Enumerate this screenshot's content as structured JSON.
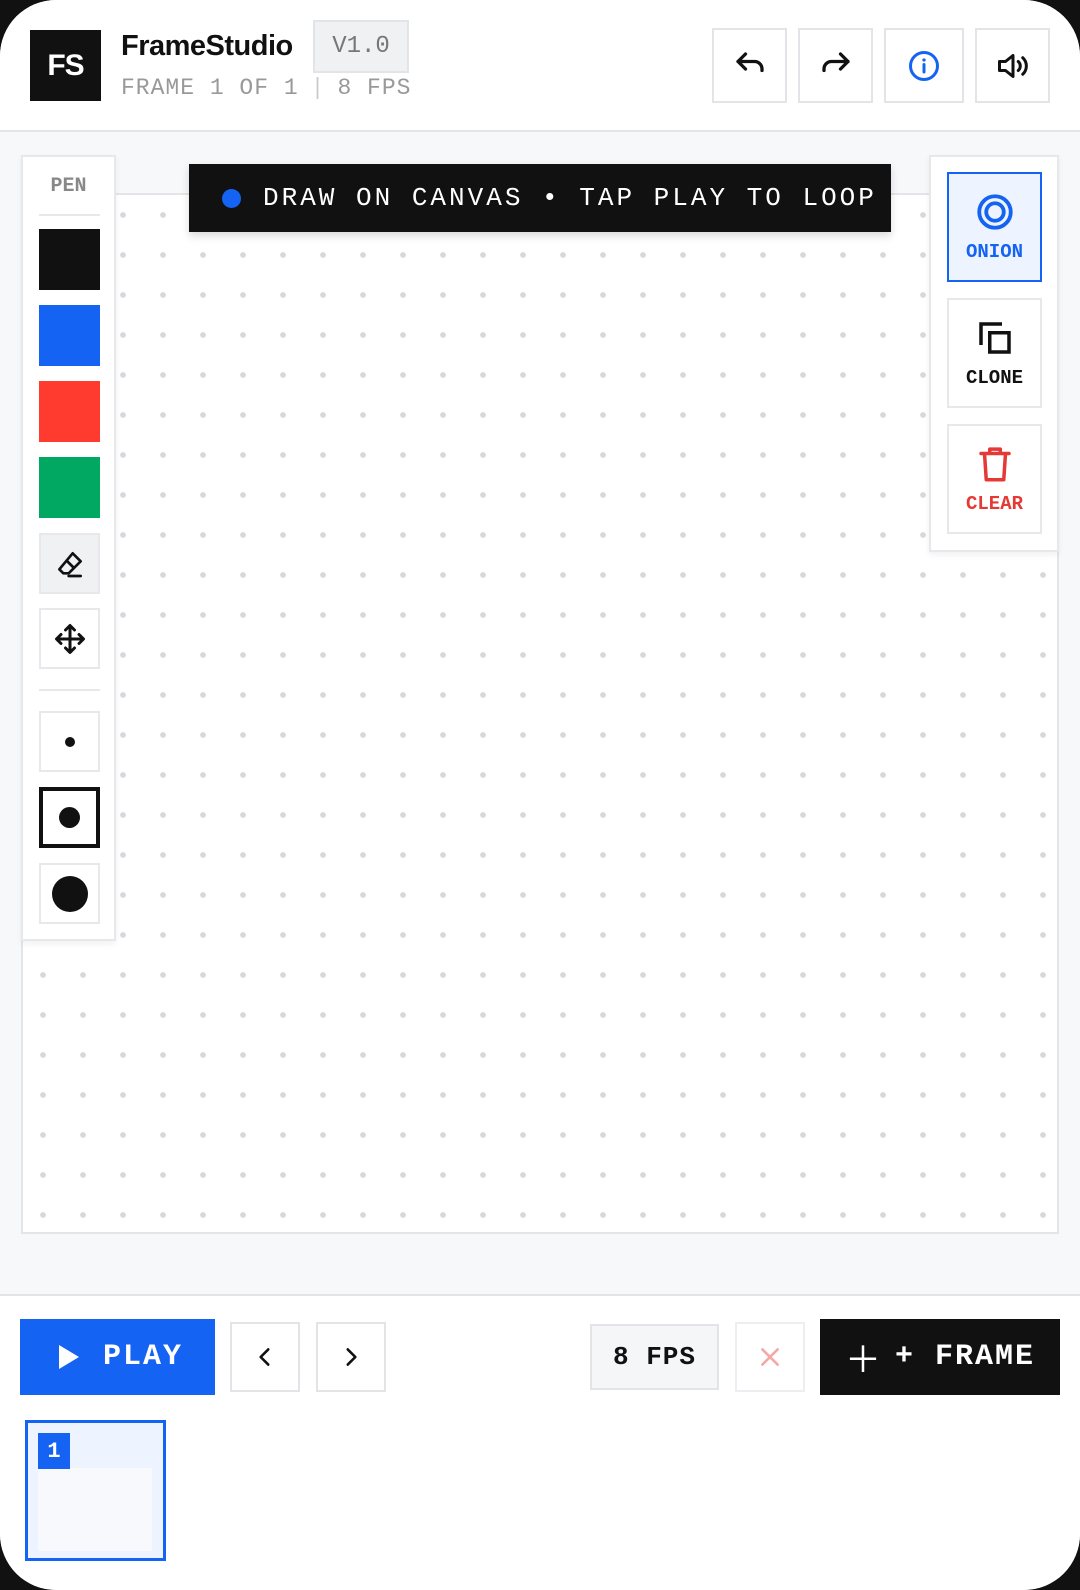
{
  "header": {
    "logo": "FS",
    "title": "FrameStudio",
    "version": "V1.0",
    "frame_status": "FRAME 1 OF 1",
    "separator": "|",
    "fps": "8 FPS",
    "buttons": [
      "undo-icon",
      "redo-icon",
      "info-icon",
      "volume-icon"
    ]
  },
  "banner": {
    "text": "DRAW ON CANVAS • TAP PLAY TO LOOP",
    "dot_color": "#1463f3"
  },
  "toolbar": {
    "label": "PEN",
    "colors": [
      "#111111",
      "#1463f3",
      "#ff3b30",
      "#00a862"
    ],
    "tools": [
      "eraser-icon",
      "move-icon"
    ],
    "brush_sizes": [
      "small",
      "medium",
      "large"
    ],
    "selected_brush": "medium"
  },
  "actions": {
    "onion_label": "ONION",
    "clone_label": "CLONE",
    "clear_label": "CLEAR"
  },
  "bottom": {
    "play_label": "PLAY",
    "fps_label": "8 FPS",
    "add_frame_label": "+ FRAME",
    "frames": [
      {
        "number": "1",
        "selected": true
      }
    ]
  },
  "colors": {
    "accent": "#1463f3",
    "danger": "#e53935",
    "dark": "#111111"
  }
}
